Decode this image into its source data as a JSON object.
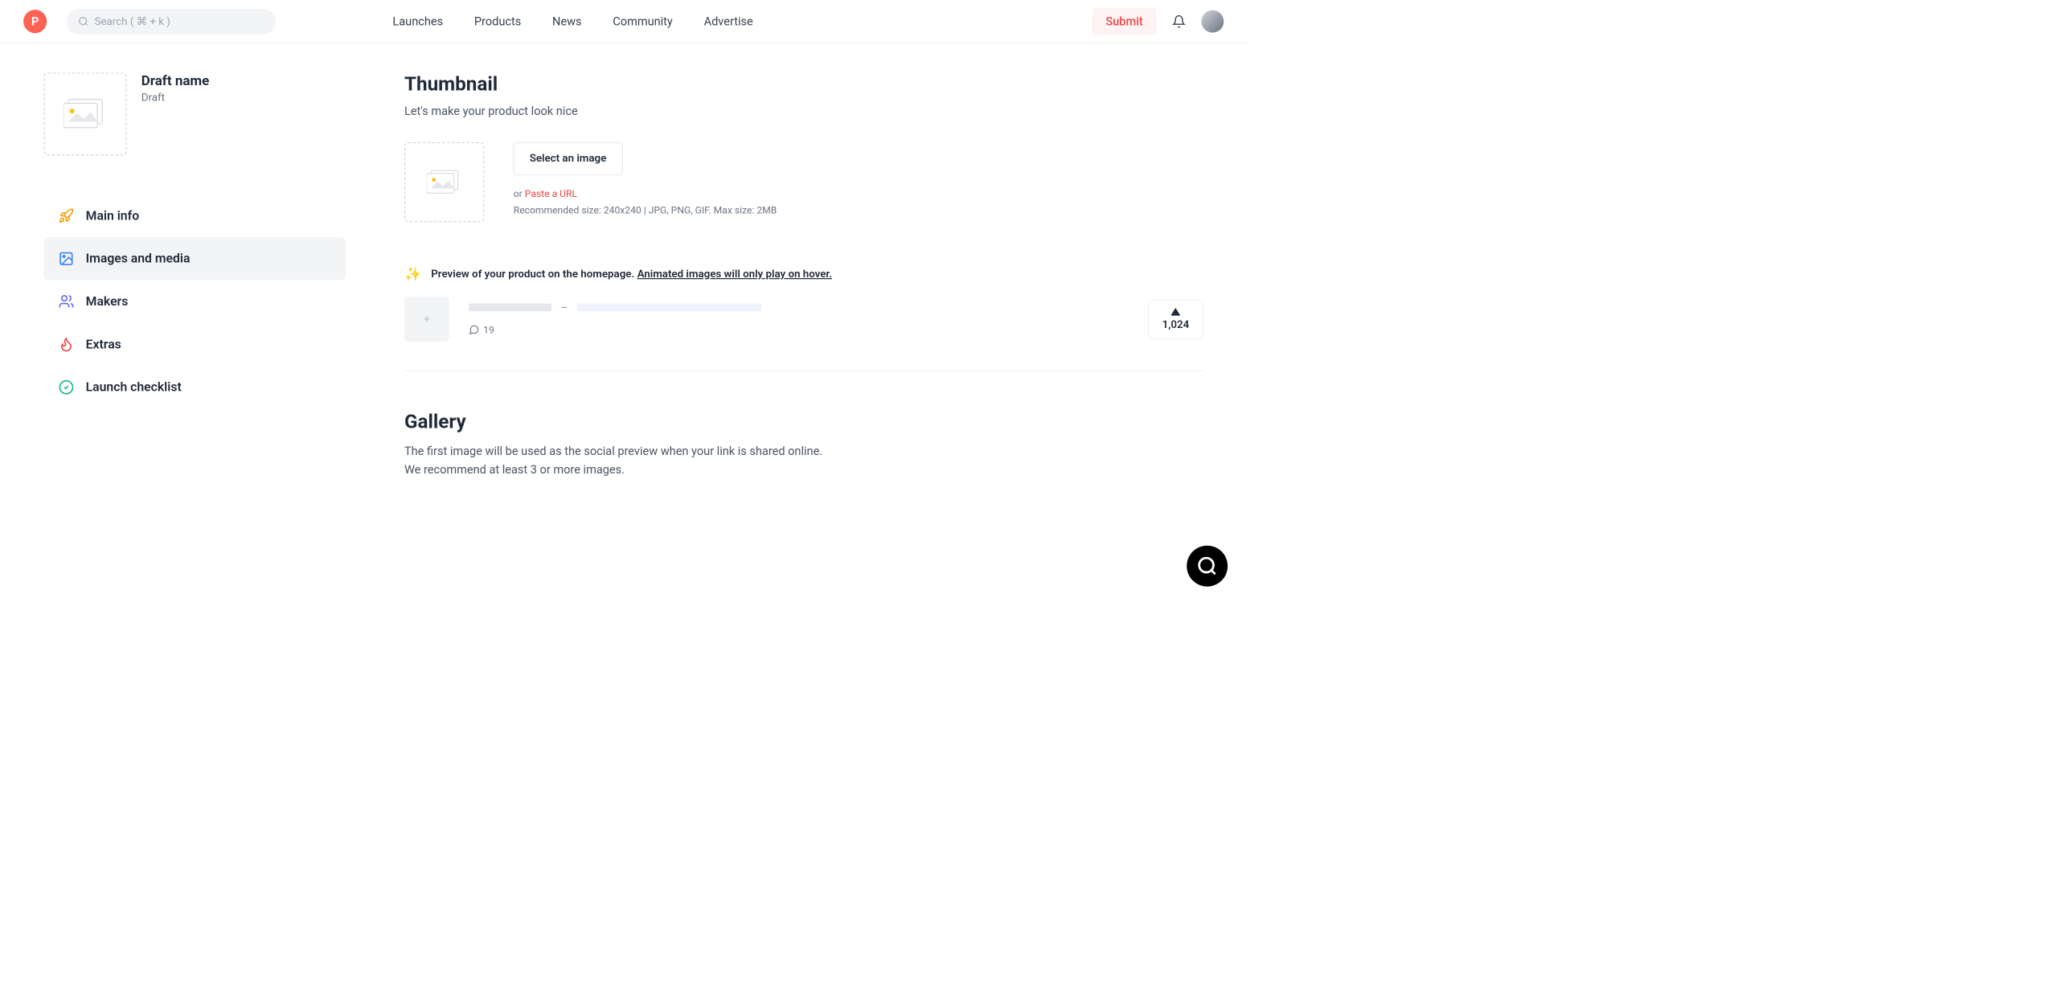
{
  "header": {
    "logo_letter": "P",
    "search_placeholder": "Search ( ⌘ + k )",
    "nav": [
      "Launches",
      "Products",
      "News",
      "Community",
      "Advertise"
    ],
    "submit_label": "Submit"
  },
  "sidebar": {
    "draft_title": "Draft name",
    "draft_status": "Draft",
    "items": [
      {
        "label": "Main info",
        "icon": "rocket",
        "color": "#f59e0b"
      },
      {
        "label": "Images and media",
        "icon": "image",
        "color": "#3b82f6",
        "active": true
      },
      {
        "label": "Makers",
        "icon": "users",
        "color": "#6366f1"
      },
      {
        "label": "Extras",
        "icon": "fire",
        "color": "#ef4444"
      },
      {
        "label": "Launch checklist",
        "icon": "check",
        "color": "#10b981"
      }
    ]
  },
  "thumbnail": {
    "title": "Thumbnail",
    "subtitle": "Let's make your product look nice",
    "select_button": "Select an image",
    "or_text": "or ",
    "paste_link": "Paste a URL",
    "recommended": "Recommended size: 240x240 | JPG, PNG, GIF. Max size: 2MB"
  },
  "preview": {
    "sparkle": "✨",
    "text": "Preview of your product on the homepage. ",
    "link_text": "Animated images will only play on hover.",
    "comment_count": "19",
    "upvote_count": "1,024"
  },
  "gallery": {
    "title": "Gallery",
    "line1": "The first image will be used as the social preview when your link is shared online.",
    "line2": "We recommend at least 3 or more images."
  }
}
